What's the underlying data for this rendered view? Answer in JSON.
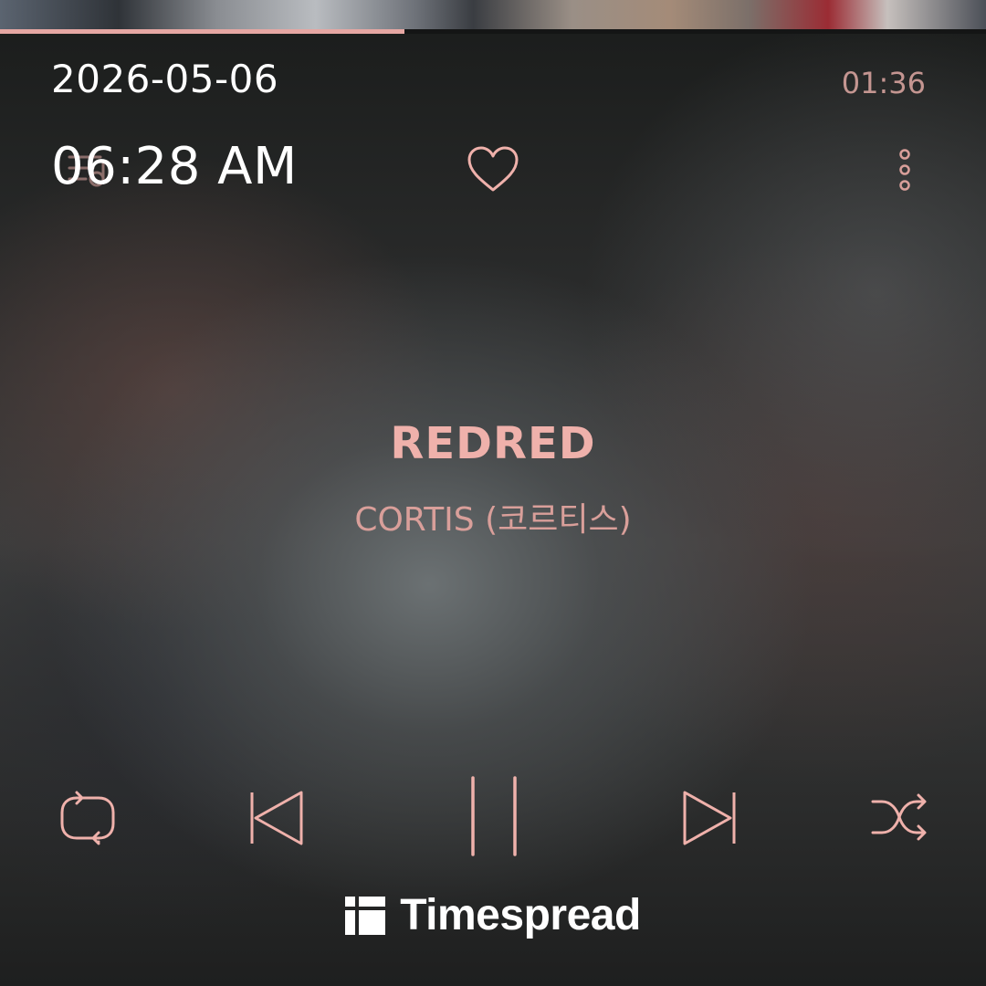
{
  "status": {
    "date": "2026-05-06",
    "time": "06:28 AM"
  },
  "player": {
    "elapsed": "01:36",
    "progress_fraction": 0.41,
    "track": {
      "title": "REDRED",
      "artist": "CORTIS (코르티스)"
    },
    "controls": {
      "repeat": "repeat-icon",
      "previous": "skip-previous-icon",
      "pause": "pause-icon",
      "next": "skip-next-icon",
      "shuffle": "shuffle-icon"
    }
  },
  "header_icons": {
    "queue": "queue-list-icon",
    "favorite": "heart-icon",
    "more": "more-vertical-icon"
  },
  "brand": {
    "name": "Timespread"
  },
  "colors": {
    "accent": "#e6a7a3",
    "text": "#ffffff"
  }
}
